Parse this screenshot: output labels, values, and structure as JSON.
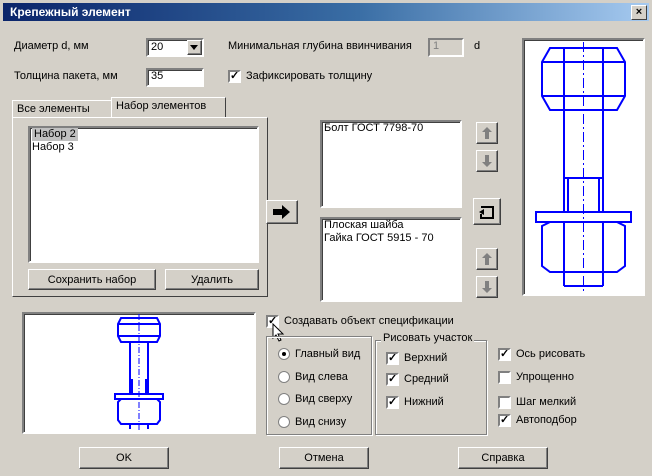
{
  "window": {
    "title": "Крепежный элемент",
    "close": "×"
  },
  "params": {
    "diameter_label": "Диаметр d, мм",
    "diameter_value": "20",
    "thickness_label": "Толщина пакета, мм",
    "thickness_value": "35",
    "min_depth_label": "Минимальная глубина ввинчивания",
    "min_depth_value": "1",
    "min_depth_unit": "d",
    "fix_thickness_label": "Зафиксировать толщину",
    "fix_thickness_checked": true
  },
  "tabs": [
    {
      "label": "Все элементы",
      "active": false
    },
    {
      "label": "Набор элементов",
      "active": true
    }
  ],
  "sets_list": [
    "Набор 2",
    "Набор 3"
  ],
  "buttons": {
    "save_set": "Сохранить набор",
    "delete": "Удалить",
    "ok": "OK",
    "cancel": "Отмена",
    "help": "Справка"
  },
  "top_list": [
    "Болт ГОСТ 7798-70"
  ],
  "bottom_list": [
    "Плоская шайба",
    "Гайка ГОСТ 5915 - 70"
  ],
  "spec": {
    "label": "Создавать объект спецификации",
    "checked": true
  },
  "views": {
    "items": [
      "Главный вид",
      "Вид слева",
      "Вид сверху",
      "Вид снизу"
    ],
    "selected": 0
  },
  "draw_section": {
    "title": "Рисовать участок",
    "items": [
      {
        "label": "Верхний",
        "checked": true
      },
      {
        "label": "Средний",
        "checked": true
      },
      {
        "label": "Нижний",
        "checked": true
      }
    ]
  },
  "options": [
    {
      "label": "Ось рисовать",
      "checked": true
    },
    {
      "label": "Упрощенно",
      "checked": false
    },
    {
      "label": "Шаг мелкий",
      "checked": false
    },
    {
      "label": "Автоподбор",
      "checked": true
    }
  ],
  "icons": {
    "dropdown": "chevron-down-icon",
    "add": "arrow-right-icon",
    "up": "arrow-up-icon",
    "down": "arrow-down-icon",
    "swap": "swap-icon"
  },
  "colors": {
    "drawing": "#0000ff",
    "title_start": "#0a246a"
  }
}
